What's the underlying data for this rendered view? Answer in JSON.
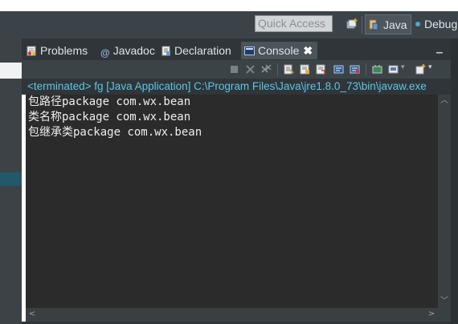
{
  "toolbar": {
    "quick_access_placeholder": "Quick Access",
    "perspectives": [
      {
        "label": "Java",
        "icon": "java-perspective-icon",
        "active": true
      },
      {
        "label": "Debug",
        "icon": "debug-perspective-icon",
        "active": false
      }
    ]
  },
  "tabs": [
    {
      "label": "Problems",
      "icon": "problems-icon",
      "active": false
    },
    {
      "label": "Javadoc",
      "icon": "javadoc-icon",
      "active": false
    },
    {
      "label": "Declaration",
      "icon": "declaration-icon",
      "active": false
    },
    {
      "label": "Console",
      "icon": "console-icon",
      "active": true,
      "close_glyph": "✖"
    }
  ],
  "console": {
    "status": "<terminated> fg [Java Application] C:\\Program Files\\Java\\jre1.8.0_73\\bin\\javaw.exe",
    "lines": [
      "包路径package com.wx.bean",
      "类名称package com.wx.bean",
      "包继承类package com.wx.bean"
    ]
  },
  "colors": {
    "toolbar_bg": "#3b4348",
    "console_bg": "#2b2b2b",
    "status_text": "#5ec6e6",
    "selection": "#23576a"
  }
}
